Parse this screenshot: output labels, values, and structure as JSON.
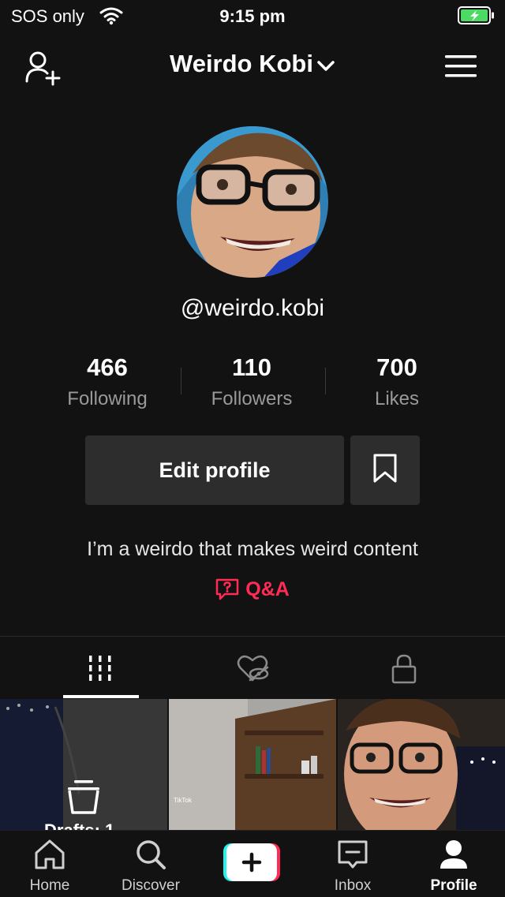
{
  "status_bar": {
    "carrier": "SOS only",
    "time": "9:15 pm"
  },
  "header": {
    "title": "Weirdo Kobi"
  },
  "profile": {
    "handle": "@weirdo.kobi",
    "stats": [
      {
        "value": "466",
        "label": "Following"
      },
      {
        "value": "110",
        "label": "Followers"
      },
      {
        "value": "700",
        "label": "Likes"
      }
    ],
    "edit_label": "Edit profile",
    "bio": "I’m a weirdo that makes weird content",
    "qa_label": "Q&A"
  },
  "grid": {
    "drafts_label": "Drafts: 1",
    "watermark": "TikTok"
  },
  "nav": {
    "home": "Home",
    "discover": "Discover",
    "inbox": "Inbox",
    "profile": "Profile"
  },
  "colors": {
    "accent": "#fe2c55",
    "background": "#121212",
    "button": "#2d2d2d",
    "battery": "#4cd964"
  }
}
